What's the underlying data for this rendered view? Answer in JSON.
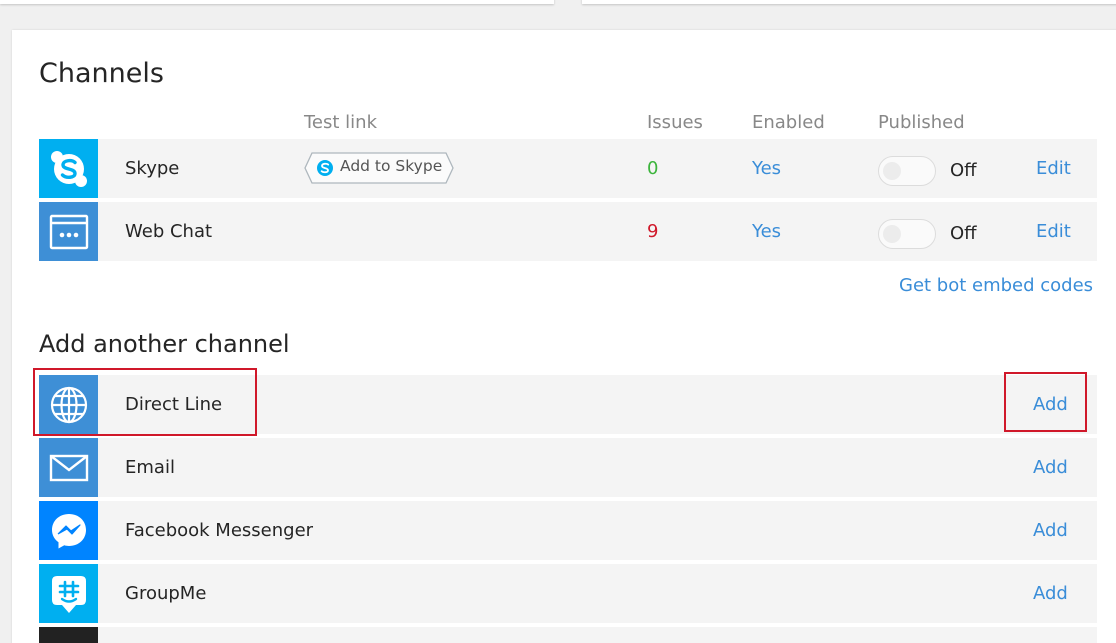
{
  "channels_title": "Channels",
  "columns": {
    "test_link": "Test link",
    "issues": "Issues",
    "enabled": "Enabled",
    "published": "Published"
  },
  "channels": [
    {
      "name": "Skype",
      "icon": "skype-icon",
      "test_link_label": "Add to Skype",
      "issues": "0",
      "issues_color": "#3cb43c",
      "enabled": "Yes",
      "published": "Off",
      "edit": "Edit"
    },
    {
      "name": "Web Chat",
      "icon": "webchat-icon",
      "issues": "9",
      "issues_color": "#d0182a",
      "enabled": "Yes",
      "published": "Off",
      "edit": "Edit"
    }
  ],
  "embed_link": "Get bot embed codes",
  "add_title": "Add another channel",
  "available_channels": [
    {
      "name": "Direct Line",
      "icon": "globe-icon",
      "action": "Add"
    },
    {
      "name": "Email",
      "icon": "envelope-icon",
      "action": "Add"
    },
    {
      "name": "Facebook Messenger",
      "icon": "messenger-icon",
      "action": "Add"
    },
    {
      "name": "GroupMe",
      "icon": "groupme-icon",
      "action": "Add"
    }
  ],
  "colors": {
    "link": "#3a8dd8",
    "skype": "#00aff0",
    "channel_blue": "#3e8fd6",
    "messenger": "#0084ff",
    "highlight": "#d0182a"
  }
}
